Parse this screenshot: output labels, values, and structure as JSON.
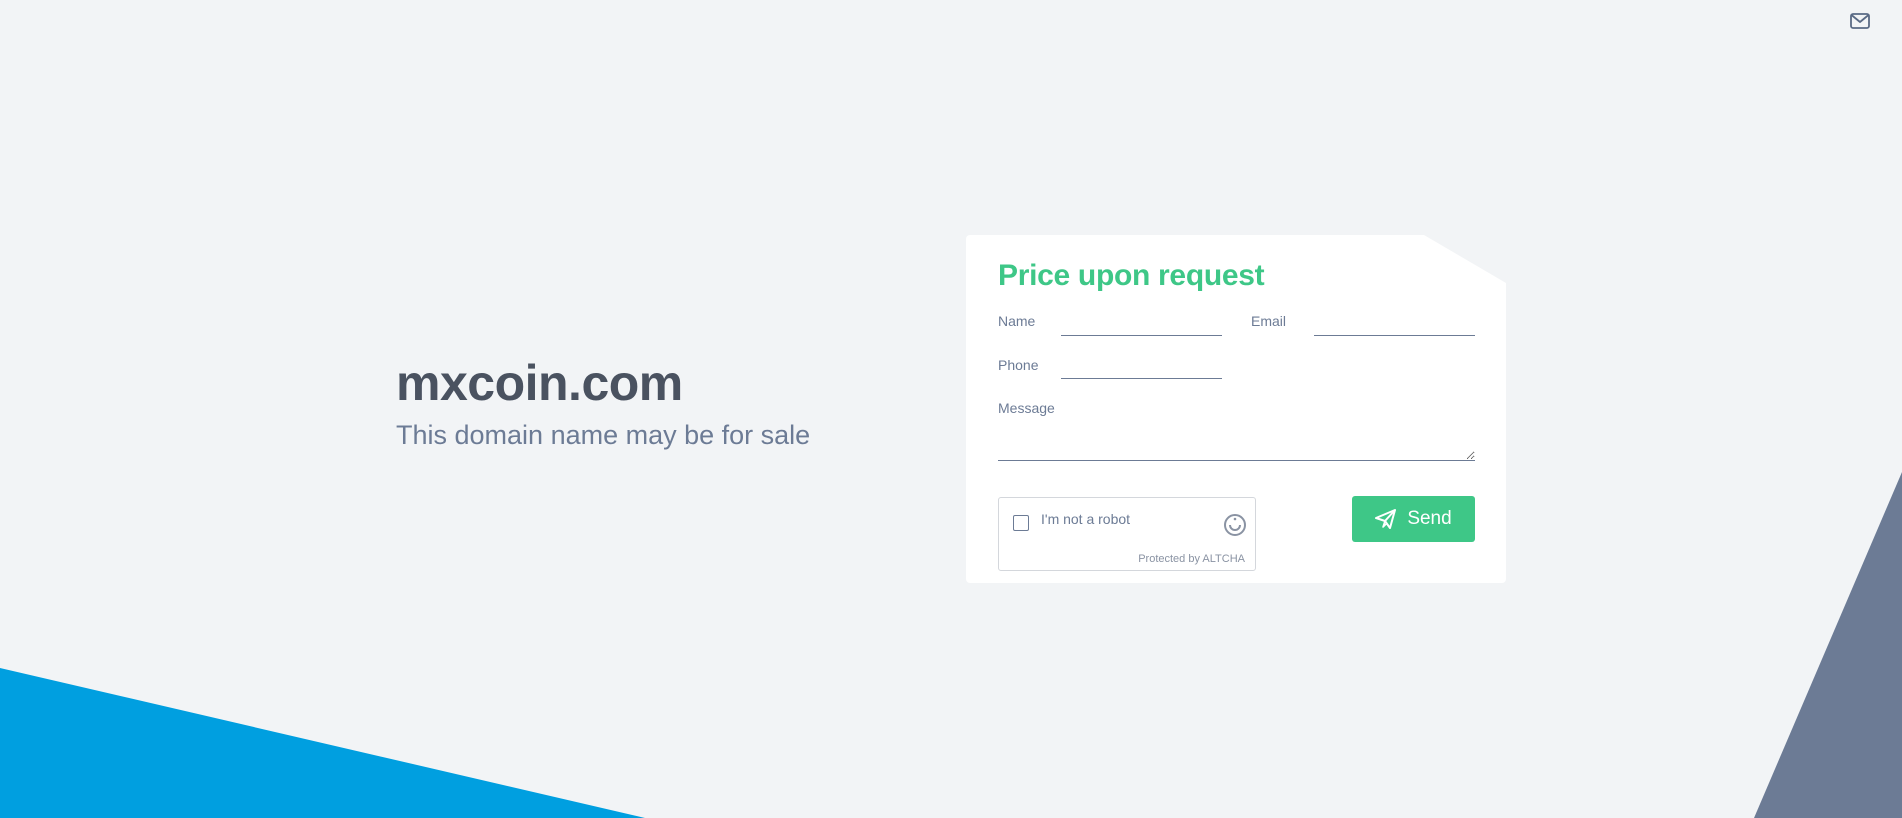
{
  "header": {
    "mail_icon": "envelope-icon"
  },
  "domain": {
    "name": "mxcoin.com",
    "tagline": "This domain name may be for sale"
  },
  "form": {
    "title": "Price upon request",
    "name_label": "Name",
    "email_label": "Email",
    "phone_label": "Phone",
    "message_label": "Message",
    "name_value": "",
    "email_value": "",
    "phone_value": "",
    "message_value": "",
    "captcha": {
      "label": "I'm not a robot",
      "footer": "Protected by ALTCHA",
      "checked": false,
      "logo_icon": "altcha-icon"
    },
    "send_label": "Send",
    "send_icon": "paper-plane-icon"
  },
  "colors": {
    "background": "#f2f4f6",
    "accent_green": "#3ec787",
    "blue_shape": "#009fe0",
    "slate_shape": "#6c7b95",
    "text_dark": "#4a5260",
    "text_muted": "#6c7b95"
  }
}
